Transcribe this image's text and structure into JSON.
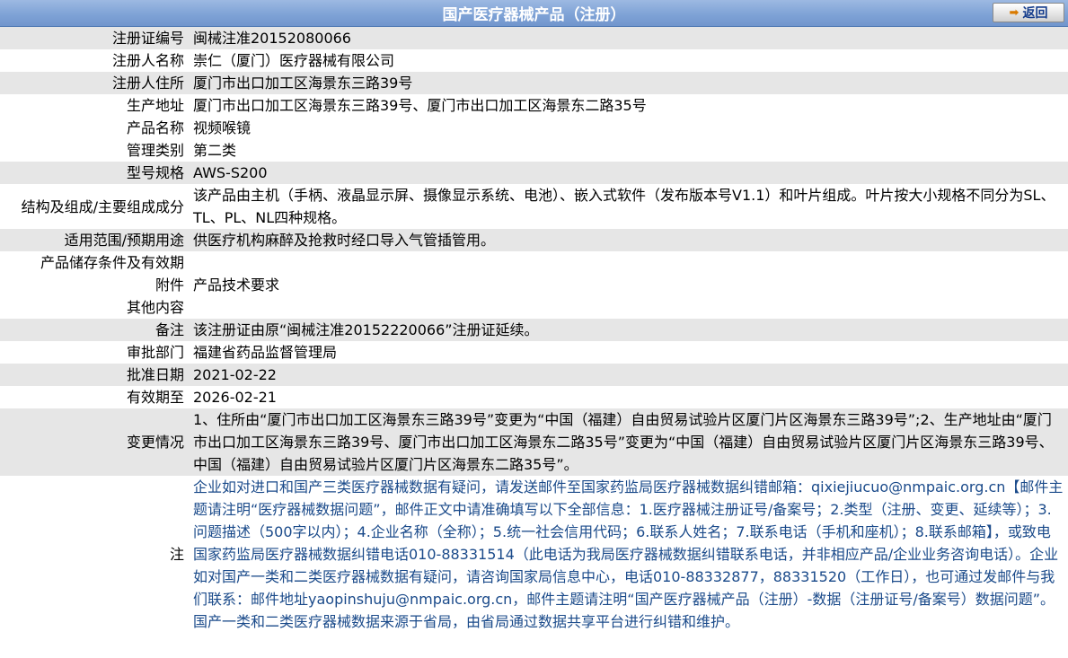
{
  "header": {
    "title": "国产医疗器械产品（注册）",
    "back_button": "返回",
    "back_icon": "arrow-right-icon"
  },
  "rows": {
    "reg_no": {
      "label": "注册证编号",
      "value": "闽械注准20152080066"
    },
    "registrant": {
      "label": "注册人名称",
      "value": "崇仁（厦门）医疗器械有限公司"
    },
    "address": {
      "label": "注册人住所",
      "value": "厦门市出口加工区海景东三路39号"
    },
    "production": {
      "label": "生产地址",
      "value": "厦门市出口加工区海景东三路39号、厦门市出口加工区海景东二路35号"
    },
    "product": {
      "label": "产品名称",
      "value": "视频喉镜"
    },
    "category": {
      "label": "管理类别",
      "value": "第二类"
    },
    "model": {
      "label": "型号规格",
      "value": "AWS-S200"
    },
    "structure": {
      "label": "结构及组成/主要组成成分",
      "value": "该产品由主机（手柄、液晶显示屏、摄像显示系统、电池）、嵌入式软件（发布版本号V1.1）和叶片组成。叶片按大小规格不同分为SL、TL、PL、NL四种规格。"
    },
    "scope": {
      "label": "适用范围/预期用途",
      "value": "供医疗机构麻醉及抢救时经口导入气管插管用。"
    },
    "storage": {
      "label": "产品储存条件及有效期",
      "value": ""
    },
    "attachment": {
      "label": "附件",
      "value": "产品技术要求"
    },
    "other": {
      "label": "其他内容",
      "value": ""
    },
    "remark": {
      "label": "备注",
      "value": "该注册证由原“闽械注准20152220066”注册证延续。"
    },
    "dept": {
      "label": "审批部门",
      "value": "福建省药品监督管理局"
    },
    "approve_date": {
      "label": "批准日期",
      "value": "2021-02-22"
    },
    "valid_until": {
      "label": "有效期至",
      "value": "2026-02-21"
    },
    "change": {
      "label": "变更情况",
      "value": "1、住所由“厦门市出口加工区海景东三路39号”变更为“中国（福建）自由贸易试验片区厦门片区海景东三路39号”;2、生产地址由“厦门市出口加工区海景东三路39号、厦门市出口加工区海景东二路35号”变更为“中国（福建）自由贸易试验片区厦门片区海景东三路39号、中国（福建）自由贸易试验片区厦门片区海景东二路35号”。"
    },
    "note": {
      "label": "注",
      "value": "企业如对进口和国产三类医疗器械数据有疑问，请发送邮件至国家药监局医疗器械数据纠错邮箱：qixiejiucuo@nmpaic.org.cn【邮件主题请注明“医疗器械数据问题”，邮件正文中请准确填写以下全部信息：1.医疗器械注册证号/备案号；2.类型（注册、变更、延续等）；3.问题描述（500字以内）；4.企业名称（全称）；5.统一社会信用代码；6.联系人姓名；7.联系电话（手机和座机）；8.联系邮箱】，或致电国家药监局医疗器械数据纠错电话010-88331514（此电话为我局医疗器械数据纠错联系电话，并非相应产品/企业业务咨询电话）。企业如对国产一类和二类医疗器械数据有疑问，请咨询国家局信息中心，电话010-88332877，88331520（工作日），也可通过发邮件与我们联系：邮件地址yaopinshuju@nmpaic.org.cn，邮件主题请注明“国产医疗器械产品（注册）-数据（注册证号/备案号）数据问题”。国产一类和二类医疗器械数据来源于省局，由省局通过数据共享平台进行纠错和维护。"
    }
  },
  "colors": {
    "header_bg": "#7fa3d6",
    "row_shade": "#e6e6e6",
    "notice_text": "#1a4a8a"
  }
}
